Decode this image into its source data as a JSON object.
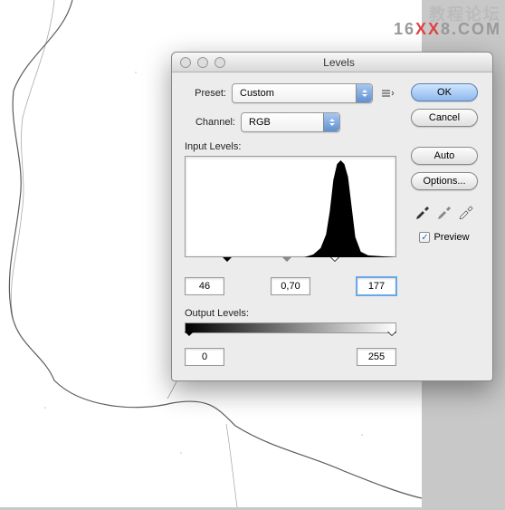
{
  "watermark": {
    "line1": "教程论坛",
    "line2_pre": "16",
    "line2_mid": "XX",
    "line2_post": "8.COM"
  },
  "dialog": {
    "title": "Levels",
    "preset_label": "Preset:",
    "preset_value": "Custom",
    "channel_label": "Channel:",
    "channel_value": "RGB",
    "input_levels_label": "Input Levels:",
    "output_levels_label": "Output Levels:",
    "input": {
      "black": "46",
      "mid": "0,70",
      "white": "177"
    },
    "output": {
      "black": "0",
      "white": "255"
    },
    "buttons": {
      "ok": "OK",
      "cancel": "Cancel",
      "auto": "Auto",
      "options": "Options..."
    },
    "preview_label": "Preview",
    "preview_checked": true,
    "slider_positions": {
      "in_black_pct": 18,
      "in_mid_pct": 46,
      "in_white_pct": 69,
      "out_black_pct": 0,
      "out_white_pct": 100
    }
  }
}
